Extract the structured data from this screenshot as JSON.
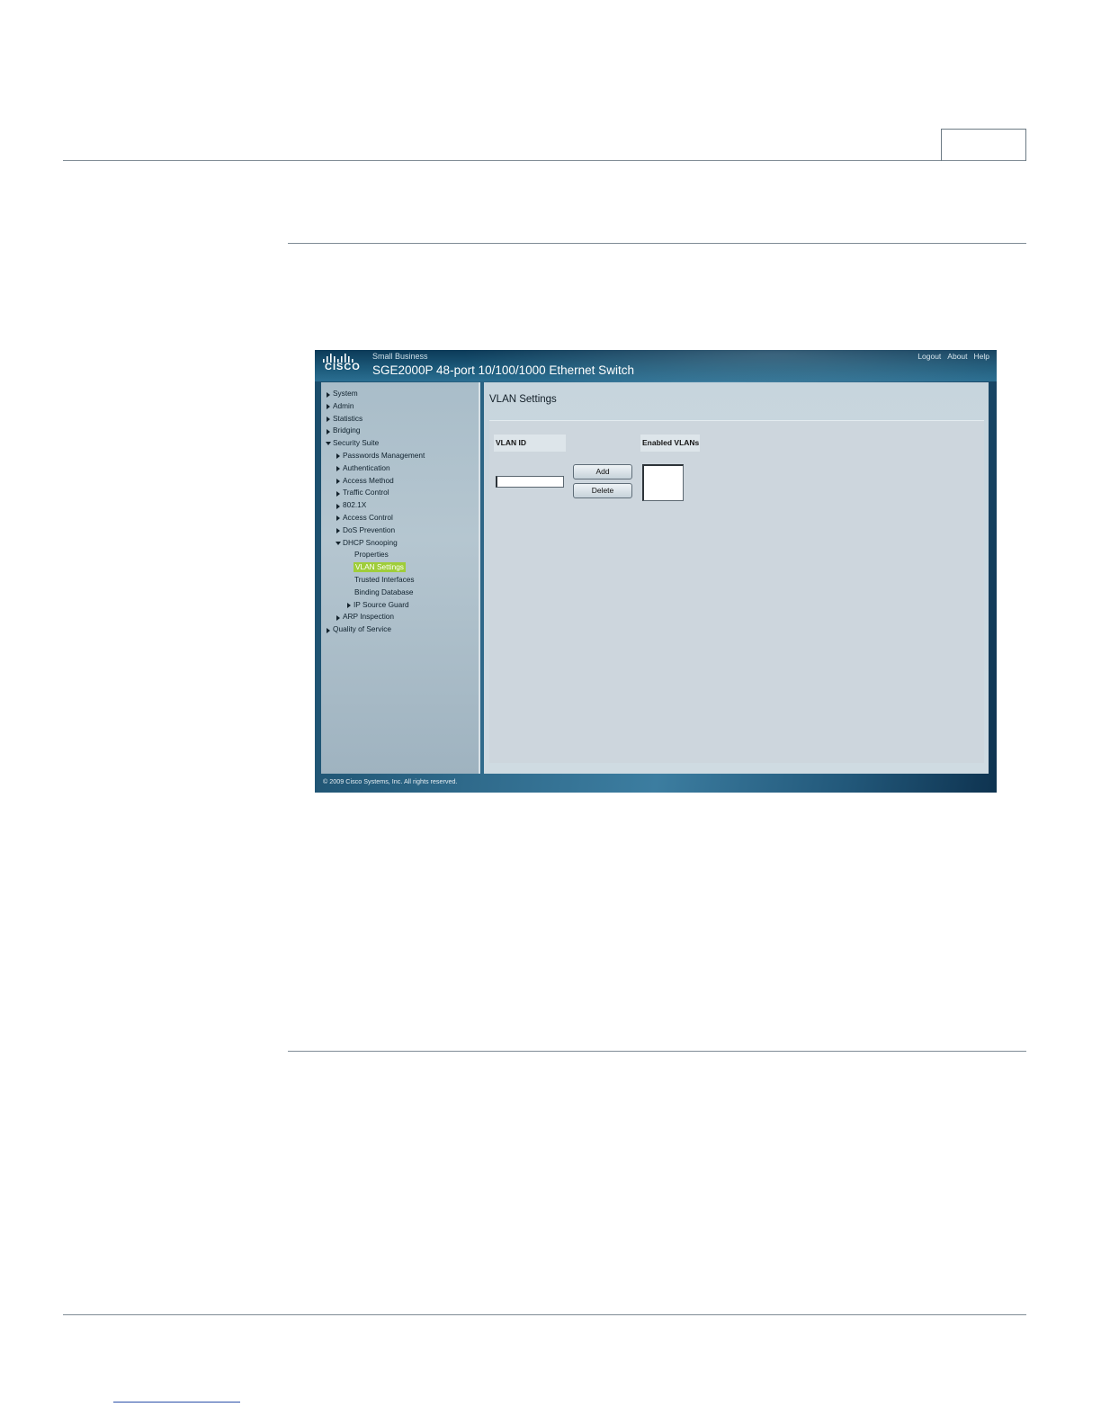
{
  "header": {
    "logo_text": "CISCO",
    "brand_line": "Small Business",
    "product_title": "SGE2000P 48-port 10/100/1000 Ethernet Switch",
    "links": [
      "Logout",
      "About",
      "Help"
    ]
  },
  "sidebar": {
    "items": [
      {
        "label": "System",
        "state": "collapsed"
      },
      {
        "label": "Admin",
        "state": "collapsed"
      },
      {
        "label": "Statistics",
        "state": "collapsed"
      },
      {
        "label": "Bridging",
        "state": "collapsed"
      },
      {
        "label": "Security Suite",
        "state": "expanded"
      },
      {
        "label": "Passwords Management",
        "state": "collapsed"
      },
      {
        "label": "Authentication",
        "state": "collapsed"
      },
      {
        "label": "Access Method",
        "state": "collapsed"
      },
      {
        "label": "Traffic Control",
        "state": "collapsed"
      },
      {
        "label": "802.1X",
        "state": "collapsed"
      },
      {
        "label": "Access Control",
        "state": "collapsed"
      },
      {
        "label": "DoS Prevention",
        "state": "collapsed"
      },
      {
        "label": "DHCP Snooping",
        "state": "expanded"
      },
      {
        "label": "Properties",
        "state": "leaf"
      },
      {
        "label": "VLAN Settings",
        "state": "selected"
      },
      {
        "label": "Trusted Interfaces",
        "state": "leaf"
      },
      {
        "label": "Binding Database",
        "state": "leaf"
      },
      {
        "label": "IP Source Guard",
        "state": "collapsed"
      },
      {
        "label": "ARP Inspection",
        "state": "collapsed"
      },
      {
        "label": "Quality of Service",
        "state": "collapsed"
      }
    ]
  },
  "main": {
    "title": "VLAN Settings",
    "vlan_id_label": "VLAN ID",
    "vlan_id_value": "",
    "enabled_vlans_label": "Enabled VLANs",
    "add_label": "Add",
    "delete_label": "Delete"
  },
  "footer": {
    "copyright": "© 2009 Cisco Systems, Inc. All rights reserved."
  },
  "colors": {
    "selected_highlight": "#9fcd3a",
    "header_dark": "#0c3a58"
  }
}
